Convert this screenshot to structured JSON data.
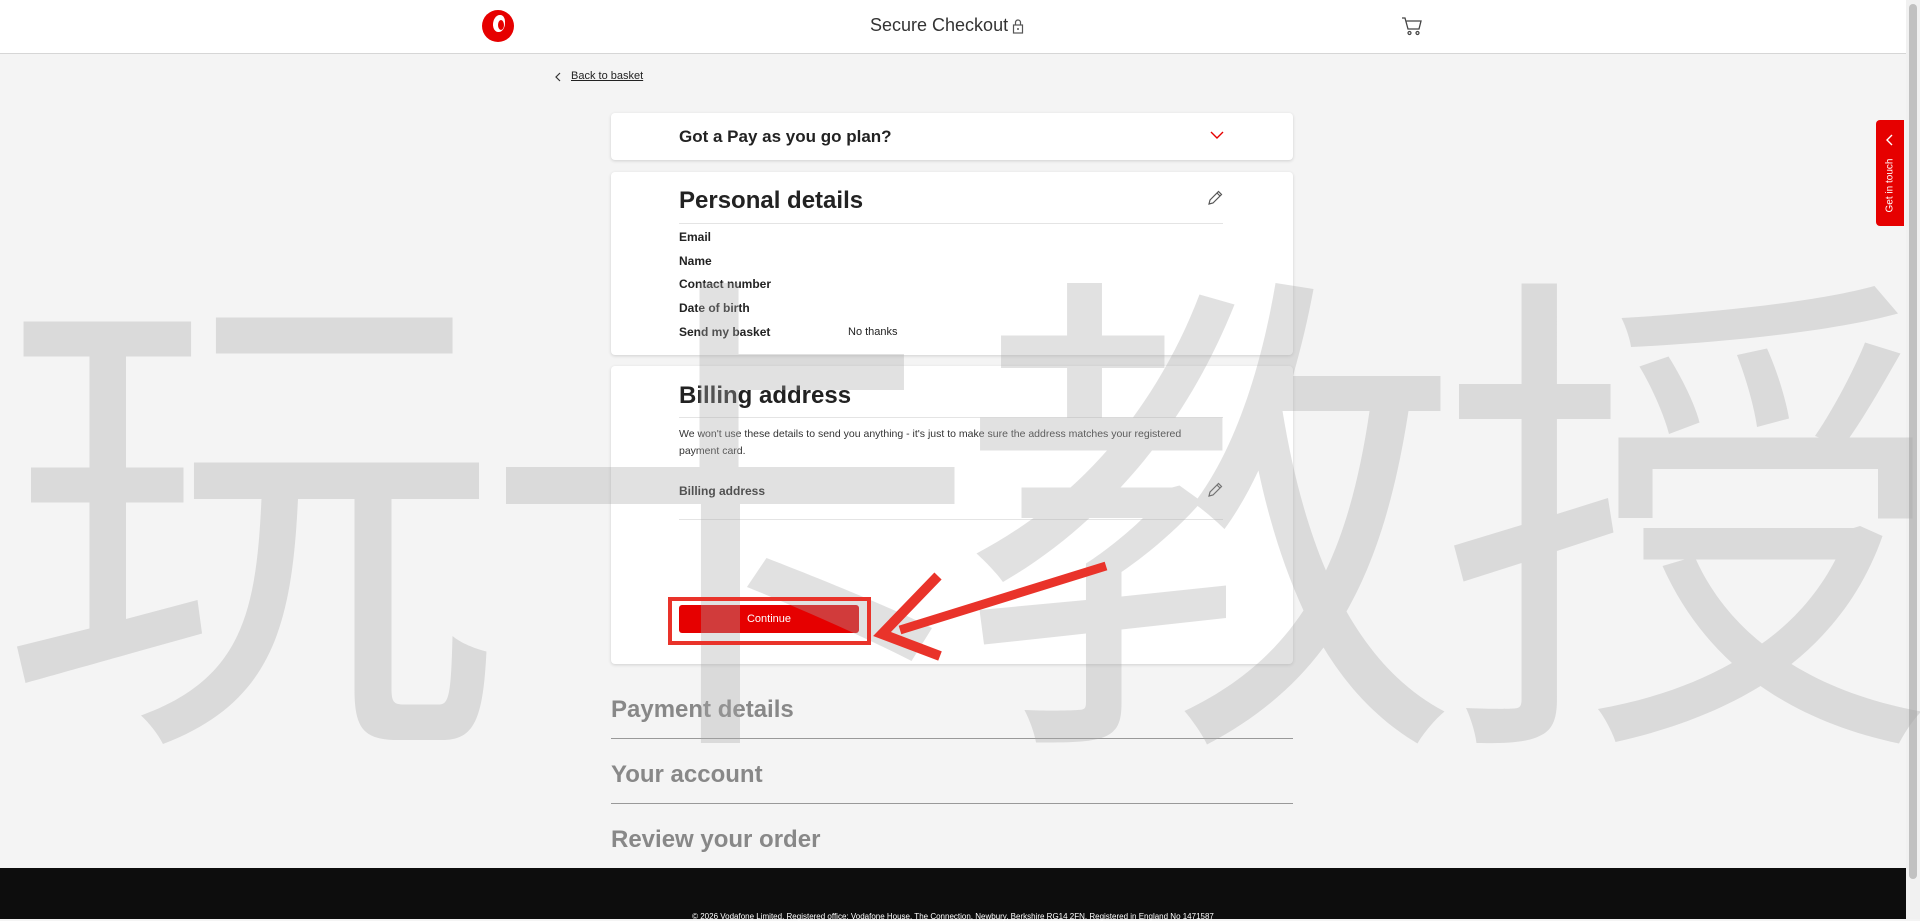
{
  "header": {
    "title": "Secure Checkout",
    "logo_icon": "vodafone-logo",
    "lock_icon": "lock-icon",
    "cart_icon": "cart-icon",
    "brand_color": "#e60000"
  },
  "back_link": "Back to basket",
  "payg": {
    "title": "Got a Pay as you go plan?"
  },
  "personal_details": {
    "title": "Personal details",
    "rows": [
      {
        "label": "Email",
        "value": ""
      },
      {
        "label": "Name",
        "value": ""
      },
      {
        "label": "Contact number",
        "value": ""
      },
      {
        "label": "Date of birth",
        "value": ""
      },
      {
        "label": "Send my basket",
        "value": "No thanks"
      }
    ]
  },
  "billing": {
    "title": "Billing address",
    "note": "We won't use these details to send you anything - it's just to make sure the address matches your registered payment card.",
    "address_label": "Billing address",
    "continue_label": "Continue"
  },
  "steps": [
    {
      "label": "Payment details"
    },
    {
      "label": "Your account"
    },
    {
      "label": "Review your order"
    }
  ],
  "get_in_touch": "Get in touch",
  "footer": {
    "text": "© 2026 Vodafone Limited. Registered office: Vodafone House, The Connection, Newbury, Berkshire RG14 2FN. Registered in England No 1471587"
  },
  "watermark": "玩卡教授"
}
